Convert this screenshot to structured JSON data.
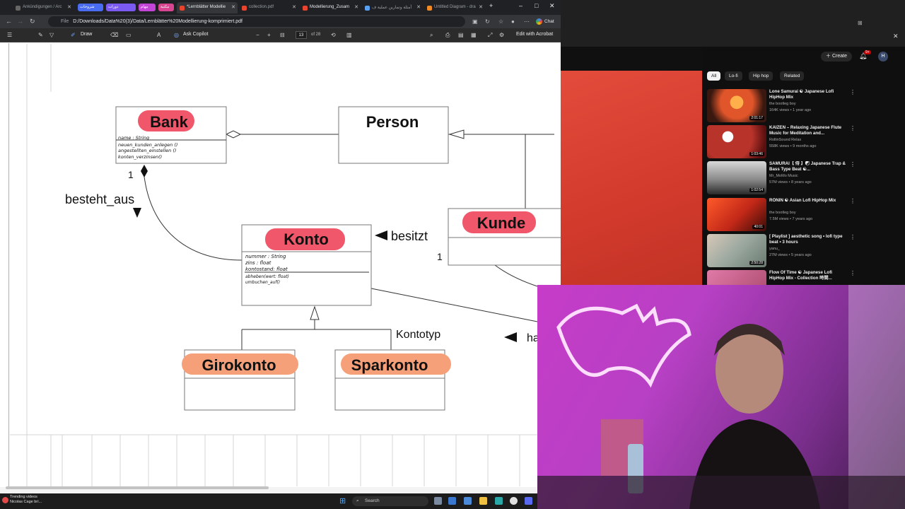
{
  "browser": {
    "tabs": [
      {
        "label": "Ankündigungen / Arc",
        "active": false
      },
      {
        "label": "*Lernblätter Modellie",
        "active": true
      },
      {
        "label": "collection.pdf",
        "active": false
      },
      {
        "label": "Modellierung_Zusam",
        "active": false
      },
      {
        "label": "أمثلة وتمارين عملية ف",
        "active": false
      },
      {
        "label": "Untitled Diagram - dra",
        "active": false
      }
    ],
    "pills": [
      "شروحات",
      "دورات",
      "مهام",
      "مكتبة"
    ],
    "address": {
      "file_label": "File",
      "url": "D:/Downloads/Data%20(3)/Data/Lernblätter%20Modellierung-komprimiert.pdf"
    },
    "chat_label": "Chat"
  },
  "pdf_toolbar": {
    "draw_label": "Draw",
    "ask_copilot_label": "Ask Copilot",
    "page_number": "13",
    "page_total": "of 28",
    "edit_label": "Edit with Acrobat"
  },
  "diagram": {
    "classes": {
      "bank": {
        "name": "Bank",
        "attributes": [
          "name : String"
        ],
        "methods": [
          "neuen_kunden_anlegen ()",
          "angestellten_einstellen ()",
          "konten_verzinsen()"
        ]
      },
      "person": {
        "name": "Person"
      },
      "kunde": {
        "name": "Kunde"
      },
      "konto": {
        "name": "Konto",
        "attributes": [
          "nummer : String",
          "zins : float",
          "kontostand: float"
        ],
        "methods": [
          "abheben(wert: float)",
          "umbuchen_auf()"
        ]
      },
      "girokonto": {
        "name": "Girokonto"
      },
      "sparkonto": {
        "name": "Sparkonto"
      }
    },
    "labels": {
      "besteht_aus": "besteht_aus",
      "besitzt": "besitzt",
      "kontotyp": "Kontotyp",
      "partial": "ha",
      "mult_bank": "1",
      "mult_kunde": "1"
    }
  },
  "youtube": {
    "create_label": "Create",
    "notification_count": "9+",
    "avatar_letter": "H",
    "chips": [
      "All",
      "Lo-fi",
      "Hip hop",
      "Related"
    ],
    "videos": [
      {
        "title": "Lone Samurai ☯ Japanese Lofi HipHop Mix",
        "channel": "the bootleg boy",
        "meta": "164K views • 1 year ago",
        "duration": "2:01:17"
      },
      {
        "title": "KAIZEN – Relaxing Japanese Flute Music for Meditation and...",
        "channel": "RollinSound Relax",
        "meta": "558K views • 9 months ago",
        "duration": "1:03:46"
      },
      {
        "title": "SAMURAI【 侍 】☯ Japanese Trap & Bass Type Beat ☯...",
        "channel": "Mr_MoMo Music",
        "meta": "57M views • 8 years ago",
        "duration": "1:02:54"
      },
      {
        "title": "RŌNIN ☯ Asian Lofi HipHop Mix",
        "channel": "the bootleg boy",
        "meta": "7.5M views • 7 years ago",
        "duration": "40:01"
      },
      {
        "title": "[ Playlist ] aesthetic song • lofi type beat • 3 hours",
        "channel": "yanu_",
        "meta": "27M views • 5 years ago",
        "duration": "2:50:28"
      },
      {
        "title": "Flow Of Time ☯ Japanese Lofi HipHop Mix - Collection 時間...",
        "channel": "",
        "meta": "",
        "duration": ""
      }
    ]
  },
  "taskbar": {
    "news_title": "Trending videos",
    "news_sub": "Nicolas Cage brí...",
    "search_label": "Search"
  },
  "colors": {
    "class_highlight": "#f0576a",
    "subclass_highlight": "#f6a07a",
    "youtube_red": "#cc0000"
  }
}
